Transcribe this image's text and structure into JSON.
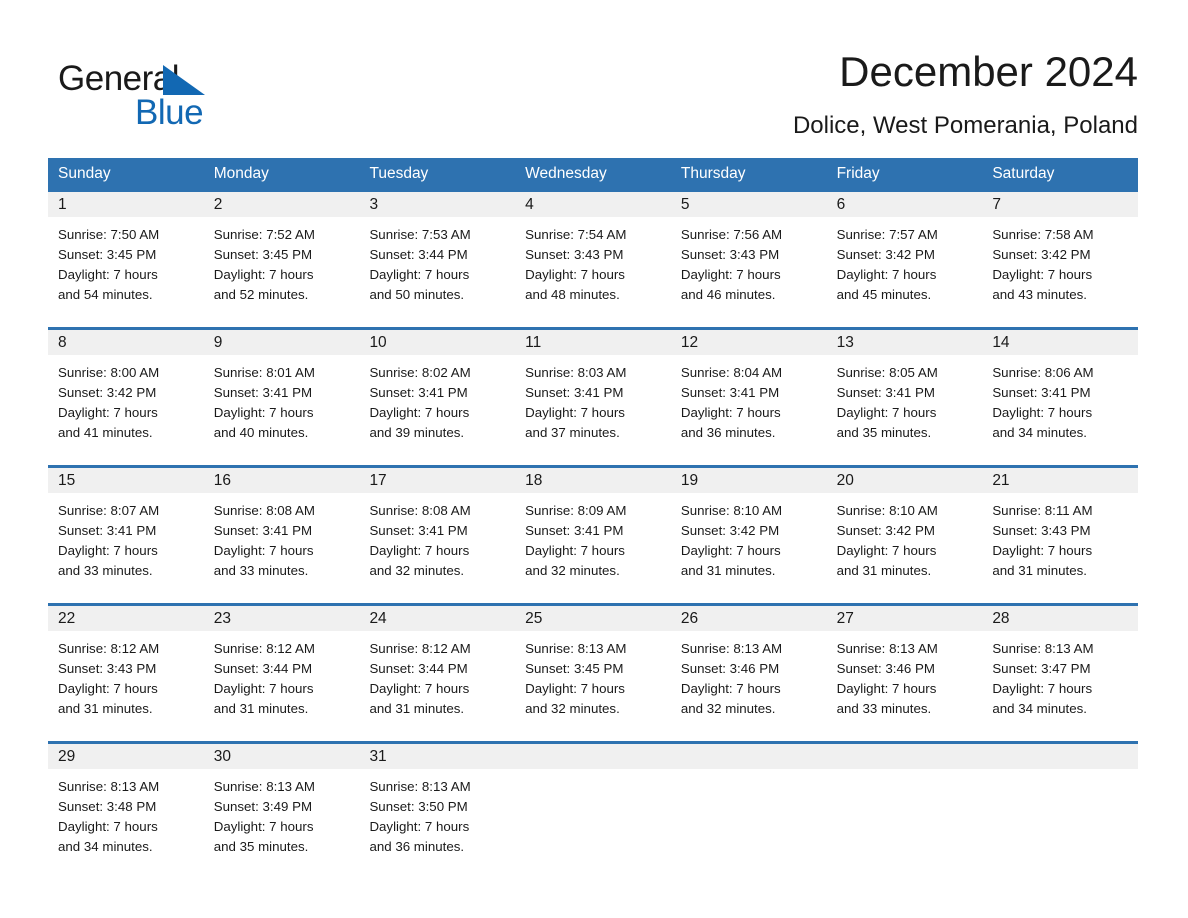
{
  "logo": {
    "word1": "General",
    "word2": "Blue",
    "triangle_color": "#1268b3"
  },
  "header": {
    "title": "December 2024",
    "subtitle": "Dolice, West Pomerania, Poland"
  },
  "theme": {
    "accent": "#2e72b0",
    "daynum_band": "#f0f0f0",
    "text": "#1a1a1a",
    "header_text": "#ffffff"
  },
  "weekdays": [
    "Sunday",
    "Monday",
    "Tuesday",
    "Wednesday",
    "Thursday",
    "Friday",
    "Saturday"
  ],
  "weeks": [
    {
      "days": [
        {
          "num": "1",
          "sunrise": "Sunrise: 7:50 AM",
          "sunset": "Sunset: 3:45 PM",
          "daylight1": "Daylight: 7 hours",
          "daylight2": "and 54 minutes."
        },
        {
          "num": "2",
          "sunrise": "Sunrise: 7:52 AM",
          "sunset": "Sunset: 3:45 PM",
          "daylight1": "Daylight: 7 hours",
          "daylight2": "and 52 minutes."
        },
        {
          "num": "3",
          "sunrise": "Sunrise: 7:53 AM",
          "sunset": "Sunset: 3:44 PM",
          "daylight1": "Daylight: 7 hours",
          "daylight2": "and 50 minutes."
        },
        {
          "num": "4",
          "sunrise": "Sunrise: 7:54 AM",
          "sunset": "Sunset: 3:43 PM",
          "daylight1": "Daylight: 7 hours",
          "daylight2": "and 48 minutes."
        },
        {
          "num": "5",
          "sunrise": "Sunrise: 7:56 AM",
          "sunset": "Sunset: 3:43 PM",
          "daylight1": "Daylight: 7 hours",
          "daylight2": "and 46 minutes."
        },
        {
          "num": "6",
          "sunrise": "Sunrise: 7:57 AM",
          "sunset": "Sunset: 3:42 PM",
          "daylight1": "Daylight: 7 hours",
          "daylight2": "and 45 minutes."
        },
        {
          "num": "7",
          "sunrise": "Sunrise: 7:58 AM",
          "sunset": "Sunset: 3:42 PM",
          "daylight1": "Daylight: 7 hours",
          "daylight2": "and 43 minutes."
        }
      ]
    },
    {
      "days": [
        {
          "num": "8",
          "sunrise": "Sunrise: 8:00 AM",
          "sunset": "Sunset: 3:42 PM",
          "daylight1": "Daylight: 7 hours",
          "daylight2": "and 41 minutes."
        },
        {
          "num": "9",
          "sunrise": "Sunrise: 8:01 AM",
          "sunset": "Sunset: 3:41 PM",
          "daylight1": "Daylight: 7 hours",
          "daylight2": "and 40 minutes."
        },
        {
          "num": "10",
          "sunrise": "Sunrise: 8:02 AM",
          "sunset": "Sunset: 3:41 PM",
          "daylight1": "Daylight: 7 hours",
          "daylight2": "and 39 minutes."
        },
        {
          "num": "11",
          "sunrise": "Sunrise: 8:03 AM",
          "sunset": "Sunset: 3:41 PM",
          "daylight1": "Daylight: 7 hours",
          "daylight2": "and 37 minutes."
        },
        {
          "num": "12",
          "sunrise": "Sunrise: 8:04 AM",
          "sunset": "Sunset: 3:41 PM",
          "daylight1": "Daylight: 7 hours",
          "daylight2": "and 36 minutes."
        },
        {
          "num": "13",
          "sunrise": "Sunrise: 8:05 AM",
          "sunset": "Sunset: 3:41 PM",
          "daylight1": "Daylight: 7 hours",
          "daylight2": "and 35 minutes."
        },
        {
          "num": "14",
          "sunrise": "Sunrise: 8:06 AM",
          "sunset": "Sunset: 3:41 PM",
          "daylight1": "Daylight: 7 hours",
          "daylight2": "and 34 minutes."
        }
      ]
    },
    {
      "days": [
        {
          "num": "15",
          "sunrise": "Sunrise: 8:07 AM",
          "sunset": "Sunset: 3:41 PM",
          "daylight1": "Daylight: 7 hours",
          "daylight2": "and 33 minutes."
        },
        {
          "num": "16",
          "sunrise": "Sunrise: 8:08 AM",
          "sunset": "Sunset: 3:41 PM",
          "daylight1": "Daylight: 7 hours",
          "daylight2": "and 33 minutes."
        },
        {
          "num": "17",
          "sunrise": "Sunrise: 8:08 AM",
          "sunset": "Sunset: 3:41 PM",
          "daylight1": "Daylight: 7 hours",
          "daylight2": "and 32 minutes."
        },
        {
          "num": "18",
          "sunrise": "Sunrise: 8:09 AM",
          "sunset": "Sunset: 3:41 PM",
          "daylight1": "Daylight: 7 hours",
          "daylight2": "and 32 minutes."
        },
        {
          "num": "19",
          "sunrise": "Sunrise: 8:10 AM",
          "sunset": "Sunset: 3:42 PM",
          "daylight1": "Daylight: 7 hours",
          "daylight2": "and 31 minutes."
        },
        {
          "num": "20",
          "sunrise": "Sunrise: 8:10 AM",
          "sunset": "Sunset: 3:42 PM",
          "daylight1": "Daylight: 7 hours",
          "daylight2": "and 31 minutes."
        },
        {
          "num": "21",
          "sunrise": "Sunrise: 8:11 AM",
          "sunset": "Sunset: 3:43 PM",
          "daylight1": "Daylight: 7 hours",
          "daylight2": "and 31 minutes."
        }
      ]
    },
    {
      "days": [
        {
          "num": "22",
          "sunrise": "Sunrise: 8:12 AM",
          "sunset": "Sunset: 3:43 PM",
          "daylight1": "Daylight: 7 hours",
          "daylight2": "and 31 minutes."
        },
        {
          "num": "23",
          "sunrise": "Sunrise: 8:12 AM",
          "sunset": "Sunset: 3:44 PM",
          "daylight1": "Daylight: 7 hours",
          "daylight2": "and 31 minutes."
        },
        {
          "num": "24",
          "sunrise": "Sunrise: 8:12 AM",
          "sunset": "Sunset: 3:44 PM",
          "daylight1": "Daylight: 7 hours",
          "daylight2": "and 31 minutes."
        },
        {
          "num": "25",
          "sunrise": "Sunrise: 8:13 AM",
          "sunset": "Sunset: 3:45 PM",
          "daylight1": "Daylight: 7 hours",
          "daylight2": "and 32 minutes."
        },
        {
          "num": "26",
          "sunrise": "Sunrise: 8:13 AM",
          "sunset": "Sunset: 3:46 PM",
          "daylight1": "Daylight: 7 hours",
          "daylight2": "and 32 minutes."
        },
        {
          "num": "27",
          "sunrise": "Sunrise: 8:13 AM",
          "sunset": "Sunset: 3:46 PM",
          "daylight1": "Daylight: 7 hours",
          "daylight2": "and 33 minutes."
        },
        {
          "num": "28",
          "sunrise": "Sunrise: 8:13 AM",
          "sunset": "Sunset: 3:47 PM",
          "daylight1": "Daylight: 7 hours",
          "daylight2": "and 34 minutes."
        }
      ]
    },
    {
      "days": [
        {
          "num": "29",
          "sunrise": "Sunrise: 8:13 AM",
          "sunset": "Sunset: 3:48 PM",
          "daylight1": "Daylight: 7 hours",
          "daylight2": "and 34 minutes."
        },
        {
          "num": "30",
          "sunrise": "Sunrise: 8:13 AM",
          "sunset": "Sunset: 3:49 PM",
          "daylight1": "Daylight: 7 hours",
          "daylight2": "and 35 minutes."
        },
        {
          "num": "31",
          "sunrise": "Sunrise: 8:13 AM",
          "sunset": "Sunset: 3:50 PM",
          "daylight1": "Daylight: 7 hours",
          "daylight2": "and 36 minutes."
        },
        {
          "num": "",
          "sunrise": "",
          "sunset": "",
          "daylight1": "",
          "daylight2": ""
        },
        {
          "num": "",
          "sunrise": "",
          "sunset": "",
          "daylight1": "",
          "daylight2": ""
        },
        {
          "num": "",
          "sunrise": "",
          "sunset": "",
          "daylight1": "",
          "daylight2": ""
        },
        {
          "num": "",
          "sunrise": "",
          "sunset": "",
          "daylight1": "",
          "daylight2": ""
        }
      ]
    }
  ]
}
